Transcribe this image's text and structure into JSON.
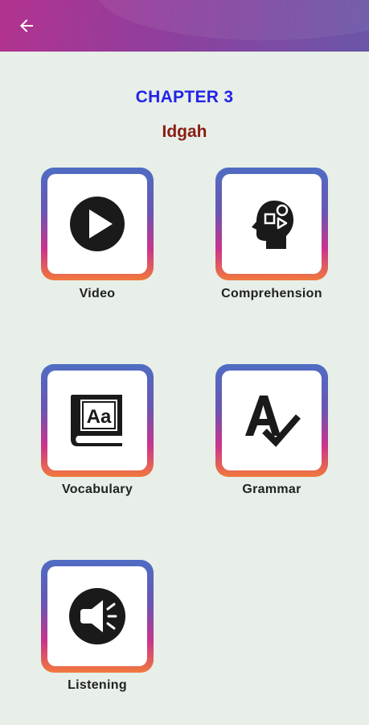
{
  "header": {
    "back_icon": "arrow-left-icon",
    "gradient_colors": [
      "#b3328f",
      "#6a56a8"
    ]
  },
  "chapter_title": "CHAPTER 3",
  "lesson_title": "Idgah",
  "colors": {
    "chapter_title": "#2323e8",
    "lesson_title": "#8a1d12",
    "background": "#e7efe8"
  },
  "modules": [
    {
      "label": "Video",
      "icon": "play-icon"
    },
    {
      "label": "Comprehension",
      "icon": "head-shapes-icon"
    },
    {
      "label": "Vocabulary",
      "icon": "dictionary-book-icon"
    },
    {
      "label": "Grammar",
      "icon": "spell-check-icon"
    },
    {
      "label": "Listening",
      "icon": "speaker-icon"
    }
  ]
}
